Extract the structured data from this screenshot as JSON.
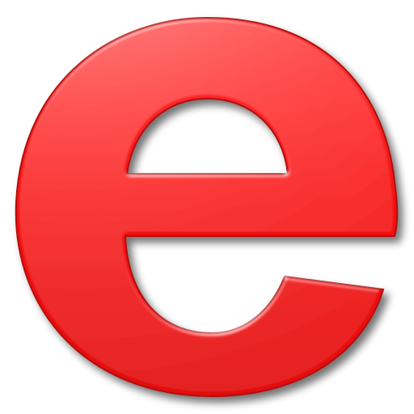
{
  "icon": {
    "name": "letter-e-icon",
    "glyph": "e"
  },
  "colors": {
    "background": "#ffffff",
    "face": "#f50f0f",
    "face_highlight": "#ff4a4a",
    "bevel_dark": "#a50808",
    "shadow": "#7a7a7a"
  }
}
